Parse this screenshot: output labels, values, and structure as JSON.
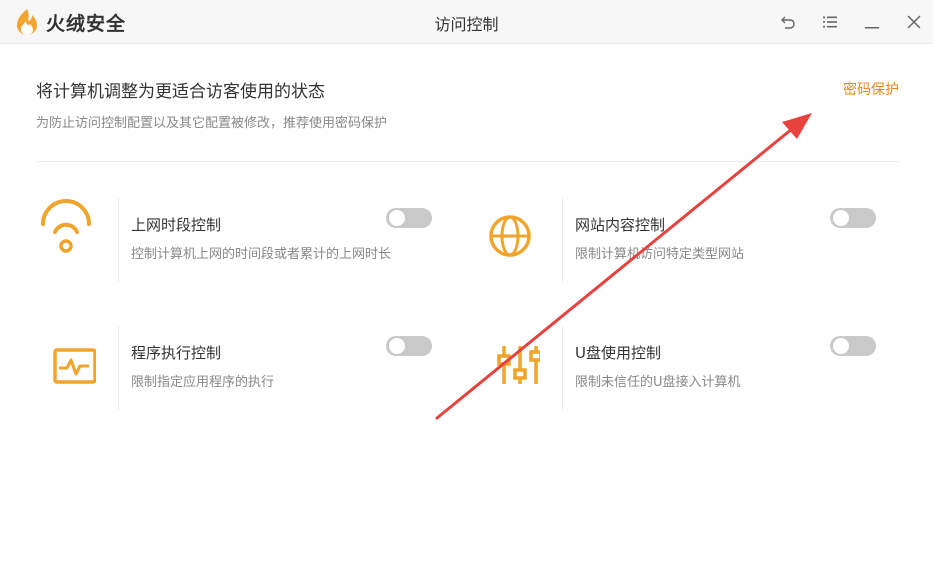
{
  "app": {
    "name": "火绒安全",
    "window_title": "访问控制"
  },
  "titlebar": {
    "buttons": [
      {
        "icon": "back-icon"
      },
      {
        "icon": "menu-icon"
      },
      {
        "icon": "minimize-icon"
      },
      {
        "icon": "close-icon"
      }
    ]
  },
  "header": {
    "title": "将计算机调整为更适合访客使用的状态",
    "subtitle": "为防止访问控制配置以及其它配置被修改，推荐使用密码保护",
    "password_link": "密码保护"
  },
  "items": [
    {
      "icon": "wifi-icon",
      "title": "上网时段控制",
      "desc": "控制计算机上网的时间段或者累计的上网时长",
      "enabled": false
    },
    {
      "icon": "globe-icon",
      "title": "网站内容控制",
      "desc": "限制计算机访问特定类型网站",
      "enabled": false
    },
    {
      "icon": "monitor-pulse-icon",
      "title": "程序执行控制",
      "desc": "限制指定应用程序的执行",
      "enabled": false
    },
    {
      "icon": "sliders-icon",
      "title": "U盘使用控制",
      "desc": "限制未信任的U盘接入计算机",
      "enabled": false
    }
  ],
  "colors": {
    "accent": "#e28a1a",
    "icon": "#f0a52a",
    "toggle_off": "#c9c9c9",
    "annotation_arrow": "#e8423f"
  }
}
